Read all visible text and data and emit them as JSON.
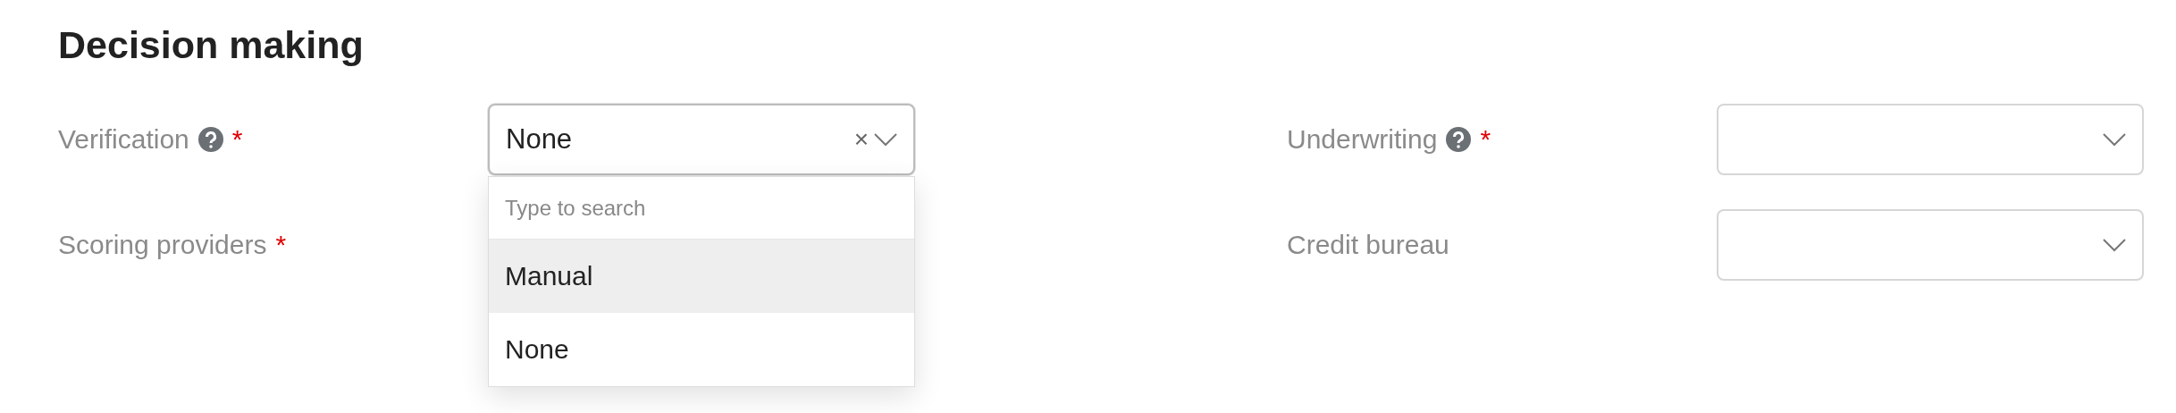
{
  "title": "Decision making",
  "columns": [
    {
      "fields": [
        {
          "label": "Verification",
          "help": true,
          "required_mark": "*",
          "select": {
            "value": "None",
            "clear": "×",
            "open": true,
            "dropdown": {
              "placeholder": "Type to search",
              "options": [
                {
                  "label": "Manual",
                  "highlighted": true
                },
                {
                  "label": "None",
                  "highlighted": false
                }
              ]
            }
          }
        },
        {
          "label": "Scoring providers",
          "help": false,
          "required_mark": "*"
        }
      ]
    },
    {
      "fields": [
        {
          "label": "Underwriting",
          "help": true,
          "required_mark": "*",
          "select": {
            "open": false
          }
        },
        {
          "label": "Credit bureau",
          "help": false,
          "select": {
            "open": false
          }
        }
      ]
    }
  ]
}
